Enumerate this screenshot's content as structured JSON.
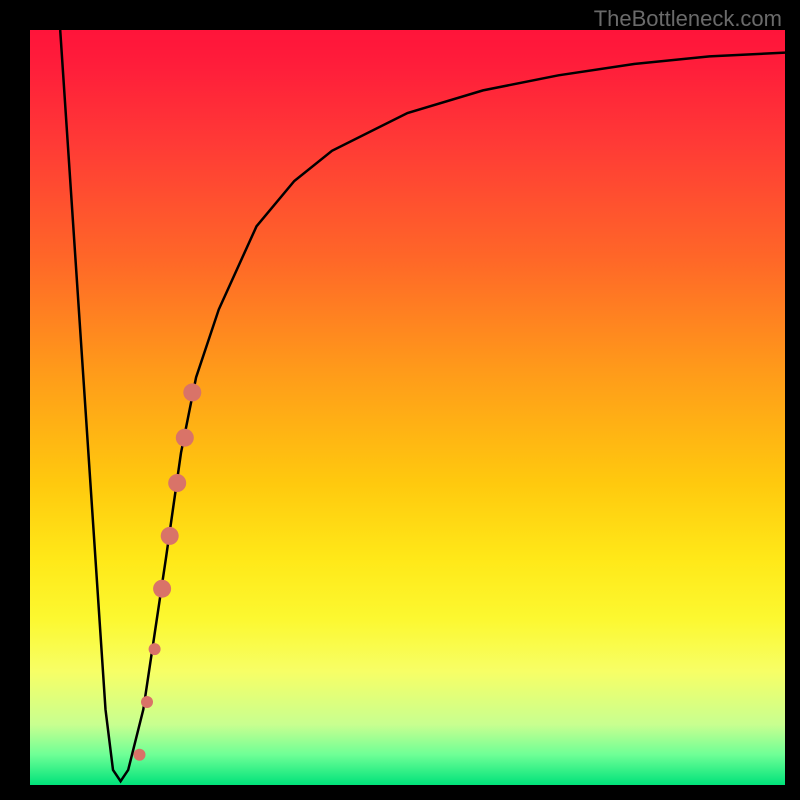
{
  "attribution": "TheBottleneck.com",
  "chart_data": {
    "type": "line",
    "title": "",
    "xlabel": "",
    "ylabel": "",
    "xlim": [
      0,
      100
    ],
    "ylim": [
      0,
      100
    ],
    "series": [
      {
        "name": "bottleneck-curve",
        "x": [
          4,
          6,
          8,
          10,
          11,
          12,
          13,
          15,
          18,
          20,
          22,
          25,
          30,
          35,
          40,
          50,
          60,
          70,
          80,
          90,
          100
        ],
        "y": [
          100,
          70,
          40,
          10,
          2,
          0.5,
          2,
          10,
          30,
          44,
          54,
          63,
          74,
          80,
          84,
          89,
          92,
          94,
          95.5,
          96.5,
          97
        ]
      }
    ],
    "markers": {
      "name": "highlighted-range",
      "color": "#d97368",
      "points": [
        {
          "x": 14.5,
          "y": 4,
          "r": 6
        },
        {
          "x": 15.5,
          "y": 11,
          "r": 6
        },
        {
          "x": 16.5,
          "y": 18,
          "r": 6
        },
        {
          "x": 17.5,
          "y": 26,
          "r": 9
        },
        {
          "x": 18.5,
          "y": 33,
          "r": 9
        },
        {
          "x": 19.5,
          "y": 40,
          "r": 9
        },
        {
          "x": 20.5,
          "y": 46,
          "r": 9
        },
        {
          "x": 21.5,
          "y": 52,
          "r": 9
        }
      ]
    },
    "background": {
      "type": "vertical-gradient",
      "stops": [
        {
          "pos": 0,
          "color": "#ff143a"
        },
        {
          "pos": 50,
          "color": "#ffb010"
        },
        {
          "pos": 78,
          "color": "#fcf830"
        },
        {
          "pos": 100,
          "color": "#00e27a"
        }
      ]
    }
  }
}
